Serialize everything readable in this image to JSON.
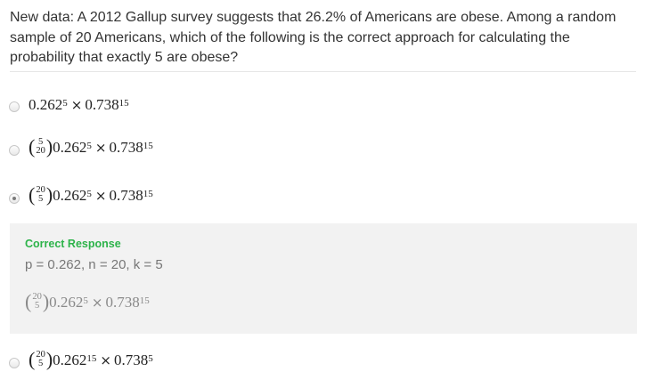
{
  "question": {
    "text": "New data: A 2012 Gallup survey suggests that 26.2% of Americans are obese. Among a random sample of 20 Americans, which of the following is the correct approach for calculating the probability that exactly 5 are obese?"
  },
  "options": [
    {
      "binom": null,
      "p": "0.262",
      "p_exp": "5",
      "times": "×",
      "q": "0.738",
      "q_exp": "15",
      "selected": false
    },
    {
      "binom": {
        "top": "5",
        "bottom": "20"
      },
      "p": "0.262",
      "p_exp": "5",
      "times": "×",
      "q": "0.738",
      "q_exp": "15",
      "selected": false
    },
    {
      "binom": {
        "top": "20",
        "bottom": "5"
      },
      "p": "0.262",
      "p_exp": "5",
      "times": "×",
      "q": "0.738",
      "q_exp": "15",
      "selected": true
    },
    {
      "binom": {
        "top": "20",
        "bottom": "5"
      },
      "p": "0.262",
      "p_exp": "15",
      "times": "×",
      "q": "0.738",
      "q_exp": "5",
      "selected": false
    }
  ],
  "feedback": {
    "title": "Correct Response",
    "params": "p = 0.262, n = 20, k = 5",
    "formula": {
      "binom": {
        "top": "20",
        "bottom": "5"
      },
      "p": "0.262",
      "p_exp": "5",
      "times": "×",
      "q": "0.738",
      "q_exp": "15"
    }
  },
  "colors": {
    "correct": "#2db34a",
    "feedback_bg": "#f2f2f2",
    "text": "#333333",
    "muted": "#777777"
  },
  "icons": {
    "radio": "radio-button-icon"
  }
}
